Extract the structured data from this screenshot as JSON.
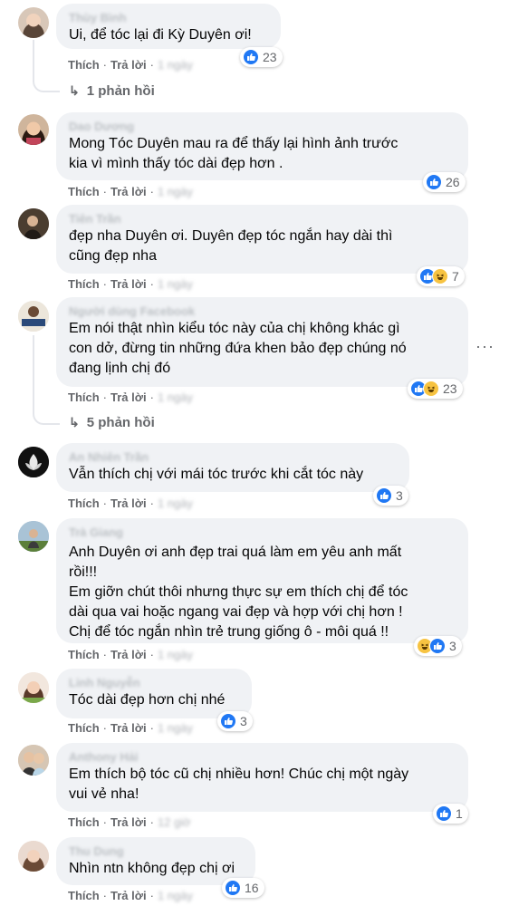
{
  "actions": {
    "like": "Thích",
    "reply": "Trả lời",
    "separator": "·"
  },
  "more_options": "···",
  "comments": [
    {
      "name": "Thùy Bình",
      "lines": [
        "Ui, để tóc lại đi Kỳ Duyên ơi!"
      ],
      "reactions": [
        "like"
      ],
      "count": "23",
      "time": "1 ngày",
      "replies": "1 phản hồi"
    },
    {
      "name": "Dao Dương",
      "lines": [
        "Mong Tóc Duyên mau ra để thấy lại hình ảnh trước",
        "kia vì mình thấy tóc dài đẹp hơn ."
      ],
      "reactions": [
        "like"
      ],
      "count": "26",
      "time": "1 ngày"
    },
    {
      "name": "Tiên Trần",
      "lines": [
        "đẹp nha Duyên ơi. Duyên đẹp tóc ngắn hay dài thì",
        "cũng đẹp nha"
      ],
      "reactions": [
        "like",
        "haha"
      ],
      "count": "7",
      "time": "1 ngày"
    },
    {
      "name": "Người dùng Facebook",
      "lines": [
        "Em nói thật nhìn kiểu tóc này của chị không khác gì",
        "con dở, đừng tin những đứa khen bảo đẹp chúng nó",
        "đang lịnh chị đó"
      ],
      "reactions": [
        "like",
        "haha"
      ],
      "count": "23",
      "time": "1 ngày",
      "replies": "5 phản hồi"
    },
    {
      "name": "An Nhiên Trần",
      "lines": [
        "Vẫn thích chị với mái tóc trước khi cắt tóc này"
      ],
      "reactions": [
        "like"
      ],
      "count": "3",
      "time": "1 ngày"
    },
    {
      "name": "Trà Giang",
      "lines": [
        "Anh Duyên ơi anh đẹp trai quá làm em yêu anh mất",
        "rồi!!!",
        "Em giỡn chút thôi nhưng thực sự em thích chị để tóc",
        "dài qua vai hoặc ngang vai đẹp và hợp với chị hơn !",
        "Chị để tóc ngắn nhìn trẻ trung giống ô - môi quá !!"
      ],
      "reactions": [
        "haha",
        "like"
      ],
      "count": "3",
      "time": "1 ngày"
    },
    {
      "name": "Linh Nguyễn",
      "lines": [
        "Tóc dài đẹp hơn chị nhé"
      ],
      "reactions": [
        "like"
      ],
      "count": "3",
      "time": "1 ngày"
    },
    {
      "name": "Anthony Hải",
      "lines": [
        "Em thích bộ tóc cũ chị nhiều hơn! Chúc chị một ngày",
        "vui vẻ nha!"
      ],
      "reactions": [
        "like"
      ],
      "count": "1",
      "time": "12 giờ"
    },
    {
      "name": "Thu Dung",
      "lines": [
        "Nhìn ntn không đẹp chị ơi"
      ],
      "reactions": [
        "like"
      ],
      "count": "16",
      "time": "1 ngày"
    }
  ],
  "colors": {
    "like": "#2078f4",
    "haha": "#f7c341",
    "bubble": "#f0f2f5",
    "meta": "#65676b"
  }
}
